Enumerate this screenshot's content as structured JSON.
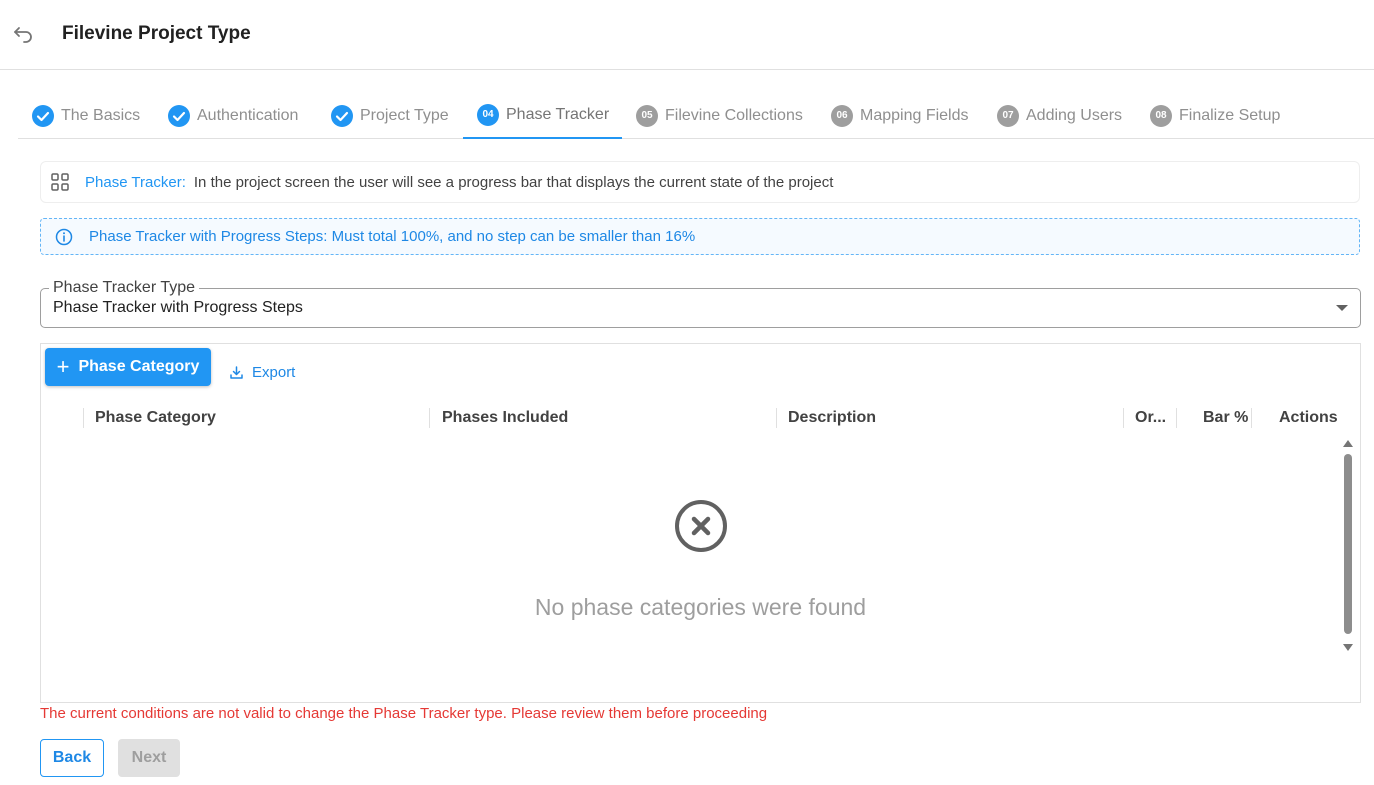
{
  "header": {
    "title": "Filevine Project Type"
  },
  "stepper": {
    "steps": [
      {
        "label": "The Basics",
        "number": "",
        "status": "completed"
      },
      {
        "label": "Authentication",
        "number": "",
        "status": "completed"
      },
      {
        "label": "Project Type",
        "number": "",
        "status": "completed"
      },
      {
        "label": "Phase Tracker",
        "number": "04",
        "status": "active"
      },
      {
        "label": "Filevine Collections",
        "number": "05",
        "status": "pending"
      },
      {
        "label": "Mapping Fields",
        "number": "06",
        "status": "pending"
      },
      {
        "label": "Adding Users",
        "number": "07",
        "status": "pending"
      },
      {
        "label": "Finalize Setup",
        "number": "08",
        "status": "pending"
      }
    ]
  },
  "info": {
    "label": "Phase Tracker:",
    "text": "In the project screen the user will see a progress bar that displays the current state of the project"
  },
  "alert": {
    "text": "Phase Tracker with Progress Steps: Must total 100%, and no step can be smaller than 16%"
  },
  "select": {
    "label": "Phase Tracker Type",
    "value": "Phase Tracker with Progress Steps"
  },
  "table": {
    "add_label": "Phase Category",
    "export_label": "Export",
    "columns": [
      "Phase Category",
      "Phases Included",
      "Description",
      "Or...",
      "Bar %",
      "Actions"
    ],
    "empty_message": "No phase categories were found"
  },
  "footer": {
    "error": "The current conditions are not valid to change the Phase Tracker type. Please review them before proceeding",
    "back_label": "Back",
    "next_label": "Next"
  },
  "colors": {
    "primary": "#2196f3",
    "error": "#e53935",
    "inactive": "#9e9e9e"
  }
}
